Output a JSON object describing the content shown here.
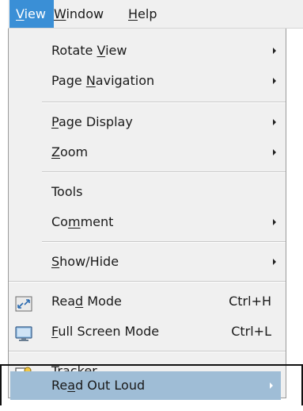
{
  "menubar": {
    "view": {
      "pre": "",
      "u": "V",
      "post": "iew"
    },
    "window": {
      "pre": "",
      "u": "W",
      "post": "indow"
    },
    "help": {
      "pre": "",
      "u": "H",
      "post": "elp"
    }
  },
  "menu": {
    "rotate_view": {
      "pre": "Rotate ",
      "u": "V",
      "post": "iew"
    },
    "page_navigation": {
      "pre": "Page ",
      "u": "N",
      "post": "avigation"
    },
    "page_display": {
      "pre": "",
      "u": "P",
      "post": "age Display"
    },
    "zoom": {
      "pre": "",
      "u": "Z",
      "post": "oom"
    },
    "tools": {
      "pre": "Tools",
      "u": "",
      "post": ""
    },
    "comment": {
      "pre": "Co",
      "u": "m",
      "post": "ment"
    },
    "show_hide": {
      "pre": "",
      "u": "S",
      "post": "how/Hide"
    },
    "read_mode": {
      "pre": "Rea",
      "u": "d",
      "post": " Mode",
      "shortcut": "Ctrl+H"
    },
    "full_screen_mode": {
      "pre": "",
      "u": "F",
      "post": "ull Screen Mode",
      "shortcut": "Ctrl+L"
    },
    "tracker": {
      "pre": "Trac",
      "u": "k",
      "post": "er..."
    },
    "read_out_loud": {
      "pre": "Re",
      "u": "a",
      "post": "d Out Loud"
    }
  },
  "icons": {
    "read_mode": "expand-arrows-icon",
    "full_screen_mode": "monitor-icon",
    "tracker": "tracker-icon"
  },
  "colors": {
    "menubar_active": "#3a8fd6",
    "highlight": "#9fbdd6",
    "menu_background": "#f0f0f0"
  }
}
